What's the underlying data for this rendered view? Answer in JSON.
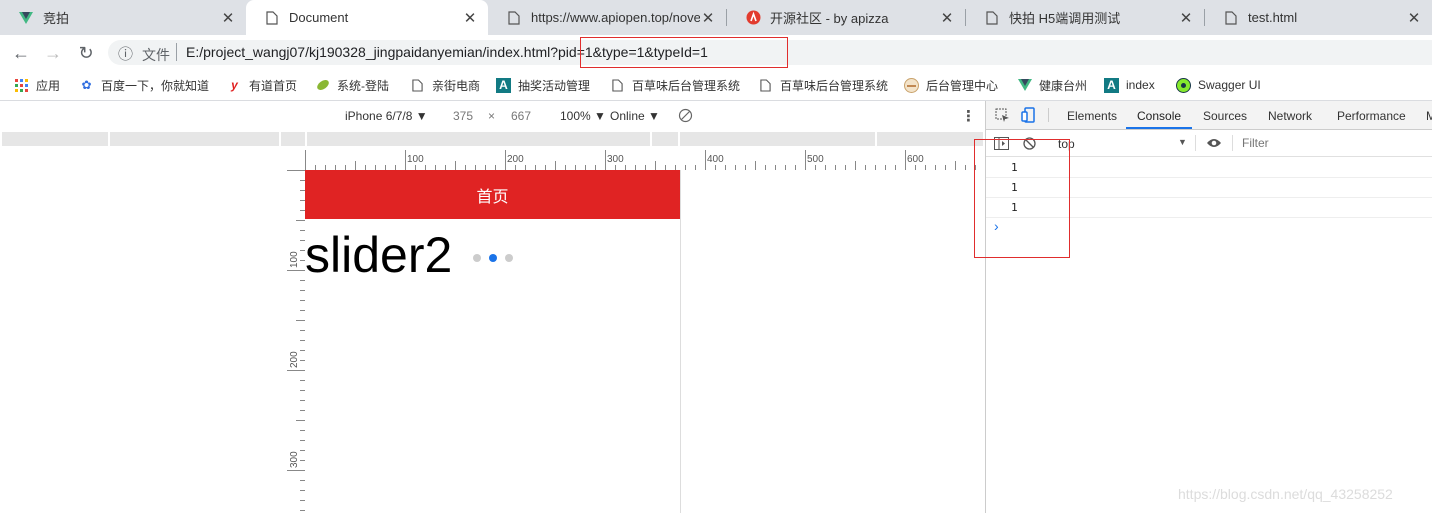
{
  "tabs": [
    {
      "title": "竞拍",
      "icon": "vue-logo-icon",
      "active": false
    },
    {
      "title": "Document",
      "icon": "page-icon",
      "active": true
    },
    {
      "title": "https://www.apiopen.top/nove",
      "icon": "page-icon",
      "active": false
    },
    {
      "title": "开源社区 - by apizza",
      "icon": "apizza-logo-icon",
      "active": false
    },
    {
      "title": "快拍 H5端调用测试",
      "icon": "page-icon",
      "active": false
    },
    {
      "title": "test.html",
      "icon": "page-icon",
      "active": false
    }
  ],
  "toolbar": {
    "back": "←",
    "forward": "→",
    "reload": "↻",
    "info": "ⓘ",
    "file_label": "文件",
    "url": "E:/project_wangj07/kj190328_jingpaidanyemian/index.html?pid=1&type=1&typeId=1"
  },
  "bookmarks": [
    {
      "label": "应用",
      "icon": "apps-grid-icon"
    },
    {
      "label": "百度一下，你就知道",
      "icon": "baidu-paw-icon"
    },
    {
      "label": "有道首页",
      "icon": "youdao-icon"
    },
    {
      "label": "系统-登陆",
      "icon": "leaf-icon"
    },
    {
      "label": "亲街电商",
      "icon": "page-icon"
    },
    {
      "label": "抽奖活动管理",
      "icon": "a-letter-icon"
    },
    {
      "label": "百草味后台管理系统",
      "icon": "page-icon"
    },
    {
      "label": "百草味后台管理系统",
      "icon": "page-icon"
    },
    {
      "label": "后台管理中心",
      "icon": "bowl-icon"
    },
    {
      "label": "健康台州",
      "icon": "vue-logo-icon"
    },
    {
      "label": "index",
      "icon": "a-letter-icon"
    },
    {
      "label": "Swagger UI",
      "icon": "swagger-icon"
    }
  ],
  "device_toolbar": {
    "device": "iPhone 6/7/8 ▼",
    "width": "375",
    "times": "×",
    "height": "667",
    "zoom": "100% ▼",
    "network": "Online ▼"
  },
  "ruler": {
    "h_labels": [
      "100",
      "200",
      "300",
      "400",
      "500",
      "600"
    ],
    "v_labels": [
      "100",
      "200",
      "300"
    ]
  },
  "page": {
    "header_title": "首页",
    "slider_text": "slider2",
    "active_dot": 1,
    "dot_count": 3
  },
  "devtools": {
    "tabs": [
      "Elements",
      "Console",
      "Sources",
      "Network",
      "Performance",
      "M"
    ],
    "active_tab": "Console",
    "context": "top",
    "filter_placeholder": "Filter",
    "log_lines": [
      "1",
      "1",
      "1"
    ],
    "prompt": "›"
  },
  "colors": {
    "header_red": "#e02323",
    "highlight_box": "#e02d2d",
    "active_blue": "#1a73e8"
  },
  "watermark": "https://blog.csdn.net/qq_43258252"
}
